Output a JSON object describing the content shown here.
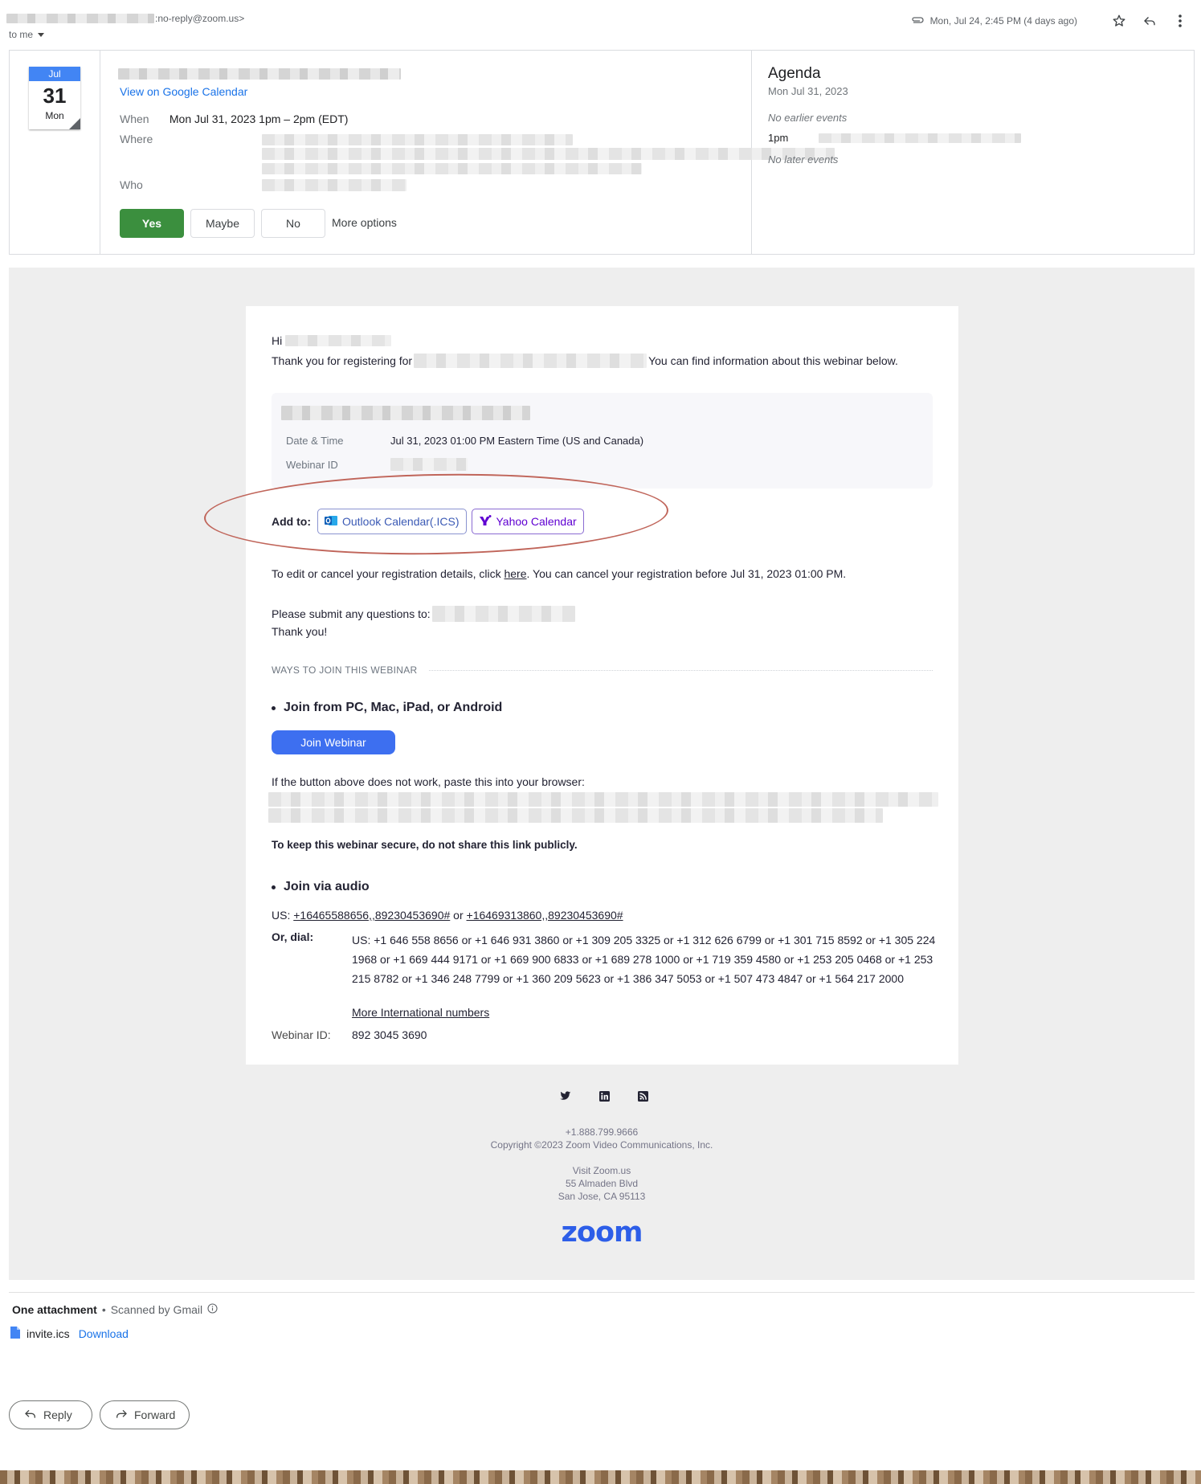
{
  "header": {
    "sender_email": ":no-reply@zoom.us>",
    "to_label": "to me",
    "date": "Mon, Jul 24, 2:45 PM (4 days ago)"
  },
  "calendar_invite": {
    "month": "Jul",
    "day": "31",
    "weekday": "Mon",
    "view_link": "View on Google Calendar",
    "when_label": "When",
    "when_value": "Mon Jul 31, 2023 1pm – 2pm (EDT)",
    "where_label": "Where",
    "who_label": "Who",
    "rsvp": {
      "yes": "Yes",
      "maybe": "Maybe",
      "no": "No",
      "more": "More options"
    },
    "agenda": {
      "title": "Agenda",
      "date": "Mon Jul 31, 2023",
      "no_earlier": "No earlier events",
      "event_time": "1pm",
      "no_later": "No later events"
    }
  },
  "email": {
    "greeting": "Hi",
    "thanks_prefix": "Thank you for registering for",
    "thanks_suffix": "You can find information about this webinar below.",
    "info": {
      "date_label": "Date & Time",
      "date_value": "Jul 31, 2023 01:00 PM Eastern Time (US and Canada)",
      "id_label": "Webinar ID"
    },
    "add_to_label": "Add to:",
    "outlook_label": "Outlook Calendar(.ICS)",
    "yahoo_label": "Yahoo Calendar",
    "edit_prefix": "To edit or cancel your registration details, click ",
    "edit_link": "here",
    "edit_suffix": ". You can cancel your registration before Jul 31, 2023 01:00 PM.",
    "submit_questions": "Please submit any questions to:",
    "thank_you": "Thank you!",
    "ways_heading": "WAYS TO JOIN THIS WEBINAR",
    "join_pc_heading": "Join from PC, Mac, iPad, or Android",
    "join_button": "Join Webinar",
    "paste_hint": "If the button above does not work, paste this into your browser:",
    "secure_note": "To keep this webinar secure, do not share this link publicly.",
    "join_audio_heading": "Join via audio",
    "us_prefix": "US: ",
    "us_number_1": "+16465588656,,89230453690#",
    "us_or": " or ",
    "us_number_2": "+16469313860,,89230453690#",
    "or_dial_label": "Or, dial:",
    "dial_numbers": "US: +1 646 558 8656 or +1 646 931 3860 or +1 309 205 3325 or +1 312 626 6799 or +1 301 715 8592 or +1 305 224 1968 or +1 669 444 9171 or +1 669 900 6833 or +1 689 278 1000 or +1 719 359 4580 or +1 253 205 0468 or +1 253 215 8782 or +1 346 248 7799 or +1 360 209 5623 or +1 386 347 5053 or +1 507 473 4847 or +1 564 217 2000",
    "more_international": "More International numbers",
    "webinar_id_label": "Webinar ID:",
    "webinar_id_value": "892 3045 3690"
  },
  "footer": {
    "phone": "+1.888.799.9666",
    "copyright": "Copyright ©2023 Zoom Video Communications, Inc.",
    "visit": "Visit Zoom.us",
    "address_1": "55 Almaden Blvd",
    "address_2": "San Jose, CA 95113",
    "logo_text": "zoom"
  },
  "attachments": {
    "heading": "One attachment",
    "scanned": "Scanned by Gmail",
    "file_name": "invite.ics",
    "download": "Download"
  },
  "actions": {
    "reply": "Reply",
    "forward": "Forward"
  },
  "colors": {
    "accent_blue": "#1a73e8",
    "yes_green": "#3b8f3e",
    "zoom_blue": "#2d5ee8",
    "annotation_red": "#c0655a"
  }
}
